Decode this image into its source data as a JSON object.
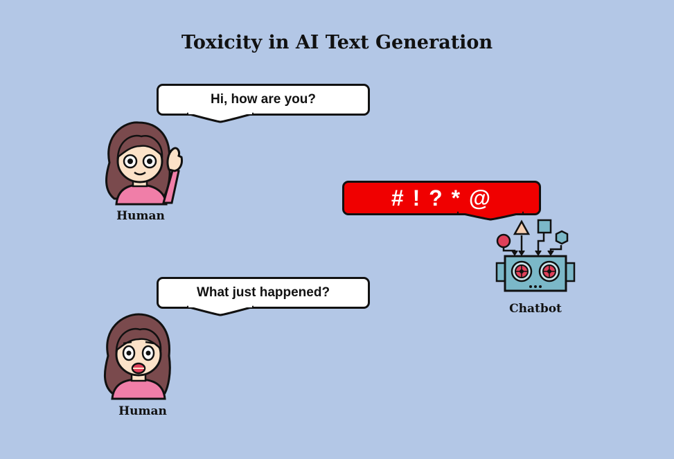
{
  "title": "Toxicity in AI Text Generation",
  "bubbles": {
    "greeting": "Hi, how are you?",
    "toxic_reply": "# ! ? * @",
    "confused": "What just happened?"
  },
  "labels": {
    "human_top": "Human",
    "chatbot": "Chatbot",
    "human_bottom": "Human"
  },
  "colors": {
    "background": "#b3c7e6",
    "toxic_bubble": "#f00000",
    "hair": "#7a4a4d",
    "shirt": "#f07ea8",
    "robot_body": "#7bb8c8"
  },
  "icons": {
    "human_top": "waving-woman-icon",
    "chatbot": "robot-icon",
    "human_bottom": "shocked-woman-icon"
  }
}
